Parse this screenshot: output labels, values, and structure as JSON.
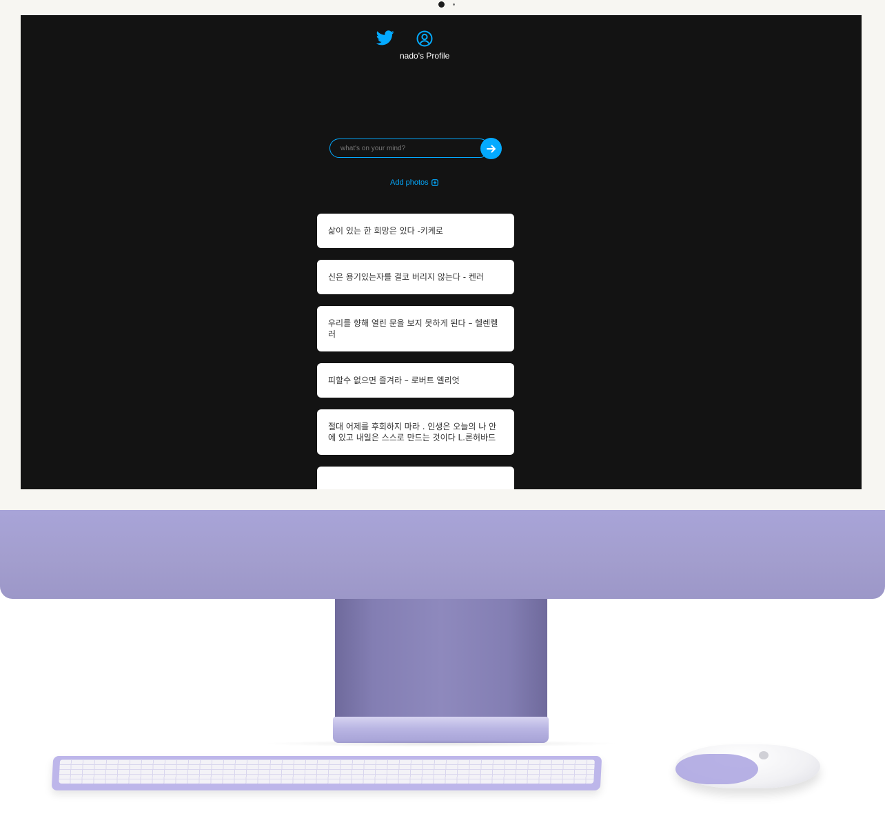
{
  "nav": {
    "profile_label": "nado's Profile"
  },
  "icons": {
    "home": "twitter-bird-icon",
    "profile": "user-circle-icon",
    "submit": "arrow-right-icon",
    "add_photos": "plus-square-icon"
  },
  "form": {
    "placeholder": "what's on your mind?",
    "value": "",
    "add_photos_label": "Add photos"
  },
  "tweets": [
    "삶이 있는 한 희망은 있다 -키케로",
    "신은 용기있는자를 결코 버리지 않는다 - 켄러",
    "우리를 향해 열린 문을 보지 못하게 된다 – 헬렌켈러",
    "피할수 없으면 즐겨라 – 로버트 엘리엇",
    "절대 어제를 후회하지 마라 . 인생은 오늘의 나 안에 있고 내일은 스스로 만드는 것이다 L.론허바드"
  ],
  "colors": {
    "accent": "#04aaff",
    "screen_bg": "#131313",
    "card_bg": "#ffffff",
    "imac_body": "#a8a4d8"
  }
}
